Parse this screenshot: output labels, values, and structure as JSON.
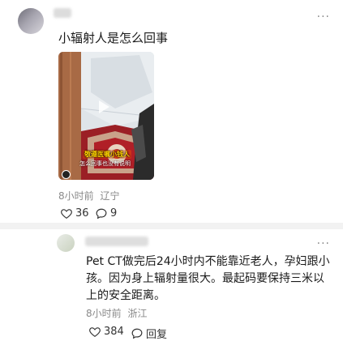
{
  "post": {
    "more_label": "···",
    "text": "小辐射人是怎么回事",
    "time": "8小时前",
    "location": "辽宁",
    "likes": "36",
    "comments": "9",
    "video": {
      "caption": "敬遵医嘱小钱人",
      "subcaption": "怎么回事也没有说明",
      "handle": "@"
    }
  },
  "reply": {
    "more_label": "···",
    "text": "Pet CT做完后24小时内不能靠近老人，孕妇跟小孩。因为身上辐射量很大。最起码要保持三米以上的安全距离。",
    "time": "8小时前",
    "location": "浙江",
    "likes": "384",
    "reply_label": "回复"
  },
  "icons": {
    "like": "heart-icon",
    "comment": "comment-bubble-icon",
    "more": "more-dots-icon",
    "play": "play-icon"
  }
}
